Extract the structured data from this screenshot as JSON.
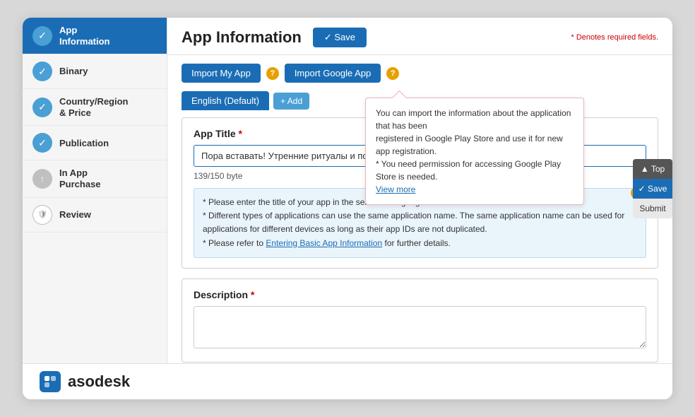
{
  "page": {
    "title": "App Information",
    "required_note": "* Denotes required fields."
  },
  "header": {
    "save_label": "✓ Save"
  },
  "sidebar": {
    "items": [
      {
        "id": "app-information",
        "label": "App\nInformation",
        "icon_type": "check",
        "active": true
      },
      {
        "id": "binary",
        "label": "Binary",
        "icon_type": "check"
      },
      {
        "id": "country-region-price",
        "label": "Country/Region\n& Price",
        "icon_type": "check"
      },
      {
        "id": "publication",
        "label": "Publication",
        "icon_type": "check"
      },
      {
        "id": "in-app-purchase",
        "label": "In App\nPurchase",
        "icon_type": "gray"
      },
      {
        "id": "review",
        "label": "Review",
        "icon_type": "white"
      }
    ]
  },
  "import": {
    "btn_my_app": "Import My App",
    "btn_google_app": "Import Google App",
    "tooltip": {
      "line1": "You can import the information about the application that has been",
      "line2": "registered in Google Play Store and use it for new app registration.",
      "line3": "* You need permission for accessing Google Play Store is needed.",
      "view_more": "View more"
    }
  },
  "tabs": {
    "active_tab": "English (Default)",
    "add_btn": "+ Add"
  },
  "app_title_section": {
    "label": "App Title",
    "required": "*",
    "value": "Пора вставать! Утренние ритуалы и полезные привычки. Без смс и регистраций :)",
    "byte_count": "139/150 byte",
    "hints": [
      "* Please enter the title of your app in the selected language.",
      "* Different types of applications can use the same application name. The same application name can be used for applications for different devices as long as their app IDs are not duplicated.",
      "* Please refer to Entering Basic App Information for further details."
    ],
    "hint_link_text": "Entering Basic App Information",
    "hint_link_suffix": " for further details."
  },
  "description_section": {
    "label": "Description",
    "required": "*",
    "placeholder": ""
  },
  "right_actions": {
    "top": "▲ Top",
    "save": "✓ Save",
    "submit": "Submit"
  },
  "footer": {
    "brand": "asodesk"
  }
}
